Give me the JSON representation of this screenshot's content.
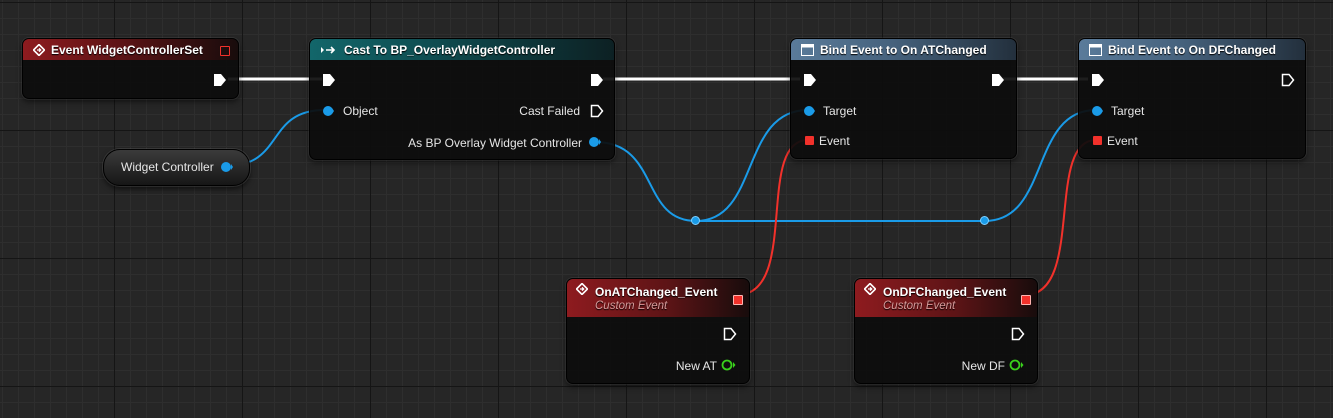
{
  "nodes": {
    "event_widget_controller_set": {
      "title": "Event WidgetControllerSet"
    },
    "cast_to": {
      "title": "Cast To BP_OverlayWidgetController",
      "object_label": "Object",
      "cast_failed_label": "Cast Failed",
      "as_label": "As BP Overlay Widget Controller"
    },
    "bind_at": {
      "title": "Bind Event to On ATChanged",
      "target_label": "Target",
      "event_label": "Event"
    },
    "bind_df": {
      "title": "Bind Event to On DFChanged",
      "target_label": "Target",
      "event_label": "Event"
    },
    "widget_controller_var": {
      "label": "Widget Controller"
    },
    "on_at_changed": {
      "title": "OnATChanged_Event",
      "subtitle": "Custom Event",
      "param_label": "New AT"
    },
    "on_df_changed": {
      "title": "OnDFChanged_Event",
      "subtitle": "Custom Event",
      "param_label": "New DF"
    }
  },
  "colors": {
    "object_pin": "#1a9be8",
    "delegate_pin": "#f2312b",
    "float_pin": "#3ad11c",
    "exec_pin": "#ffffff",
    "event_header": "#8e1b1f",
    "cast_header": "#12666a",
    "function_header": "#5a7b9a"
  }
}
